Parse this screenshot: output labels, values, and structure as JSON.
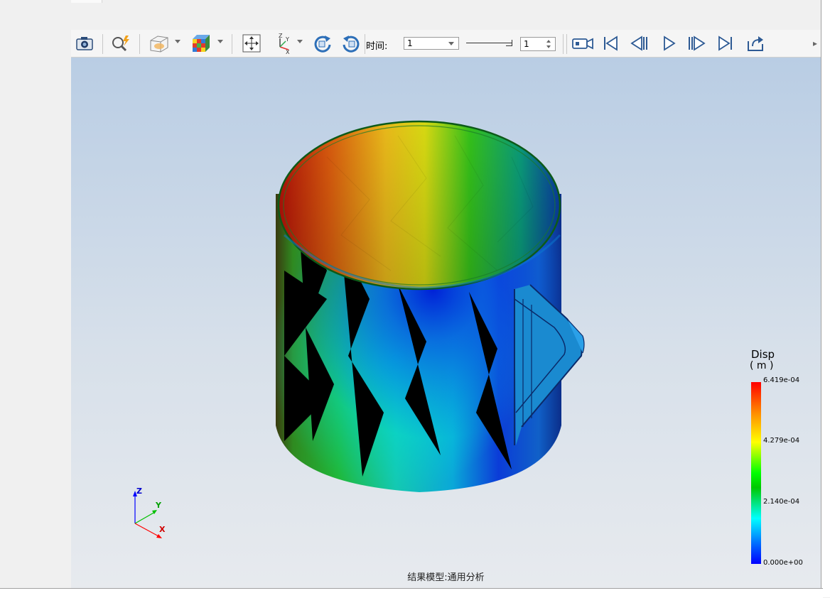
{
  "toolbar": {
    "time_label": "时间:",
    "time_combo_value": "1",
    "frame_spin_value": "1",
    "icons": [
      "camera-icon",
      "zoom-icon",
      "view-cube-icon",
      "color-cube-icon",
      "fit-icon",
      "axes-icon",
      "rotate-cw-icon",
      "rotate-ccw-icon",
      "record-icon",
      "first-frame-icon",
      "prev-frame-icon",
      "play-icon",
      "next-frame-icon",
      "last-frame-icon",
      "export-icon"
    ]
  },
  "legend": {
    "title": "Disp",
    "unit": "( m )",
    "ticks": [
      "6.419e-04",
      "4.279e-04",
      "2.140e-04",
      "0.000e+00"
    ],
    "colors": [
      "#ff0000",
      "#ffff00",
      "#00ff00",
      "#00ffff",
      "#0000ff"
    ]
  },
  "axes": {
    "z": "Z",
    "y": "Y",
    "x": "X"
  },
  "footer": {
    "model_label": "结果模型:通用分析"
  }
}
